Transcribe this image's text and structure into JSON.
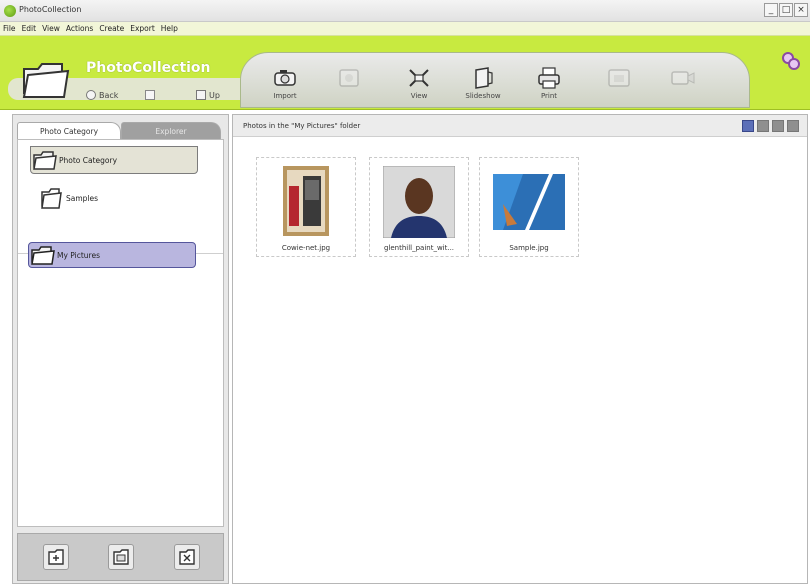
{
  "window": {
    "title": "PhotoCollection",
    "controls": [
      "_",
      "□",
      "×"
    ]
  },
  "menu": [
    "File",
    "Edit",
    "View",
    "Actions",
    "Create",
    "Export",
    "Help"
  ],
  "toolbar": {
    "app_name": "PhotoCollection",
    "back_label": "Back",
    "forward_label": "Up",
    "tools": [
      {
        "label": "Import",
        "icon": "camera-icon",
        "enabled": true
      },
      {
        "label": "",
        "icon": "photo-icon",
        "enabled": false
      },
      {
        "label": "View",
        "icon": "view-icon",
        "enabled": true
      },
      {
        "label": "Slideshow",
        "icon": "slideshow-icon",
        "enabled": true
      },
      {
        "label": "Print",
        "icon": "printer-icon",
        "enabled": true
      },
      {
        "label": "",
        "icon": "share-icon",
        "enabled": false
      },
      {
        "label": "",
        "icon": "video-icon",
        "enabled": false
      }
    ]
  },
  "sidebar": {
    "tabs": [
      {
        "label": "Photo Category",
        "active": true
      },
      {
        "label": "Explorer",
        "active": false
      }
    ],
    "tree": {
      "root": "Photo Category",
      "sample": "Samples",
      "selected": "My Pictures"
    },
    "bottom_buttons": [
      "new-folder-icon",
      "rename-folder-icon",
      "delete-folder-icon"
    ]
  },
  "content": {
    "header": "Photos in the \"My Pictures\" folder",
    "view_modes": [
      "large-thumbnails",
      "small-thumbnails",
      "list",
      "details"
    ],
    "photos": [
      {
        "caption": "Cowie-net.jpg"
      },
      {
        "caption": "glenthill_paint_wit..."
      },
      {
        "caption": "Sample.jpg"
      }
    ]
  },
  "colors": {
    "toolbar_green": "#c8ea40",
    "selected_node": "#b9b6df",
    "menu_bg": "#f2f6d8"
  }
}
